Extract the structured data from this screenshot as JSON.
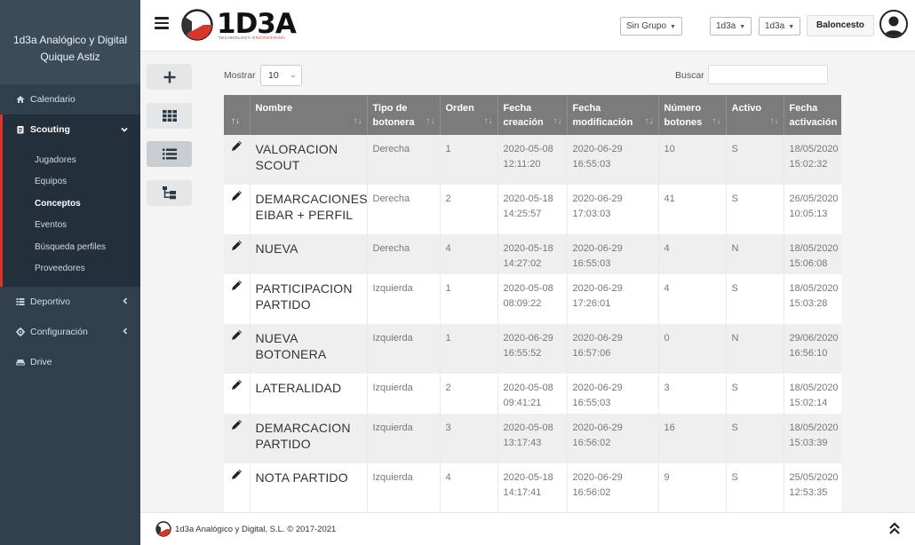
{
  "sidebar": {
    "org_name": "1d3a Analógico y Digital",
    "user_name": "Quique Astiz",
    "items": [
      {
        "label": "Calendario",
        "icon": "home-icon"
      },
      {
        "label": "Scouting",
        "icon": "clipboard-icon"
      },
      {
        "label": "Deportivo",
        "icon": "list-icon"
      },
      {
        "label": "Configuración",
        "icon": "gear-icon"
      },
      {
        "label": "Drive",
        "icon": "drive-icon"
      }
    ],
    "scouting_subitems": [
      "Jugadores",
      "Equipos",
      "Conceptos",
      "Eventos",
      "Búsqueda perfiles",
      "Proveedores"
    ]
  },
  "topbar": {
    "logo_text": "1D3A",
    "logo_sub_a": "TECHNOLOGY",
    "logo_sub_b": "ENGINEERING",
    "group_select": "Sin Grupo",
    "select_a": "1d3a",
    "select_b": "1d3a",
    "sport_button": "Baloncesto"
  },
  "controls": {
    "show_label": "Mostrar",
    "show_value": "10",
    "search_label": "Buscar",
    "search_value": ""
  },
  "table": {
    "headers": {
      "nombre": "Nombre",
      "tipo_a": "Tipo de",
      "tipo_b": "botonera",
      "orden": "Orden",
      "fc_a": "Fecha",
      "fc_b": "creación",
      "fm_a": "Fecha",
      "fm_b": "modificación",
      "nb_a": "Número",
      "nb_b": "botones",
      "activo": "Activo",
      "fa_a": "Fecha",
      "fa_b": "activación"
    },
    "rows": [
      {
        "n1": "VALORACION",
        "n2": "SCOUT",
        "tipo": "Derecha",
        "orden": "1",
        "fc1": "2020-05-08",
        "fc2": "12:11:20",
        "fm1": "2020-06-29",
        "fm2": "16:55:03",
        "nb": "10",
        "activo": "S",
        "fa1": "18/05/2020",
        "fa2": "15:02:32"
      },
      {
        "n1": "DEMARCACIONES",
        "n2": "EIBAR + PERFIL",
        "tipo": "Derecha",
        "orden": "2",
        "fc1": "2020-05-18",
        "fc2": "14:25:57",
        "fm1": "2020-06-29",
        "fm2": "17:03:03",
        "nb": "41",
        "activo": "S",
        "fa1": "26/05/2020",
        "fa2": "10:05:13"
      },
      {
        "n1": "NUEVA",
        "n2": "",
        "tipo": "Derecha",
        "orden": "4",
        "fc1": "2020-05-18",
        "fc2": "14:27:02",
        "fm1": "2020-06-29",
        "fm2": "16:55:03",
        "nb": "4",
        "activo": "N",
        "fa1": "18/05/2020",
        "fa2": "15:06:08"
      },
      {
        "n1": "PARTICIPACION",
        "n2": "PARTIDO",
        "tipo": "Izquierda",
        "orden": "1",
        "fc1": "2020-05-08",
        "fc2": "08:09:22",
        "fm1": "2020-06-29",
        "fm2": "17:26:01",
        "nb": "4",
        "activo": "S",
        "fa1": "18/05/2020",
        "fa2": "15:03:28"
      },
      {
        "n1": "NUEVA",
        "n2": "BOTONERA",
        "tipo": "Izquierda",
        "orden": "1",
        "fc1": "2020-06-29",
        "fc2": "16:55:52",
        "fm1": "2020-06-29",
        "fm2": "16:57:06",
        "nb": "0",
        "activo": "N",
        "fa1": "29/06/2020",
        "fa2": "16:56:10"
      },
      {
        "n1": "LATERALIDAD",
        "n2": "",
        "tipo": "Izquierda",
        "orden": "2",
        "fc1": "2020-05-08",
        "fc2": "09:41:21",
        "fm1": "2020-06-29",
        "fm2": "16:55:03",
        "nb": "3",
        "activo": "S",
        "fa1": "18/05/2020",
        "fa2": "15:02:14"
      },
      {
        "n1": "DEMARCACION",
        "n2": "PARTIDO",
        "tipo": "Izquierda",
        "orden": "3",
        "fc1": "2020-05-08",
        "fc2": "13:17:43",
        "fm1": "2020-06-29",
        "fm2": "16:56:02",
        "nb": "16",
        "activo": "S",
        "fa1": "18/05/2020",
        "fa2": "15:03:39"
      },
      {
        "n1": "NOTA PARTIDO",
        "n2": "",
        "tipo": "Izquierda",
        "orden": "4",
        "fc1": "2020-05-18",
        "fc2": "14:17:41",
        "fm1": "2020-06-29",
        "fm2": "16:56:02",
        "nb": "9",
        "activo": "S",
        "fa1": "25/05/2020",
        "fa2": "12:53:35"
      }
    ]
  },
  "footer": {
    "text": "1d3a Analógico y Digital, S.L. © 2017-2021"
  },
  "colors": {
    "sidebar_bg": "#2f3f4d",
    "accent": "#d9362b",
    "header_bg": "#7b7b7b"
  }
}
